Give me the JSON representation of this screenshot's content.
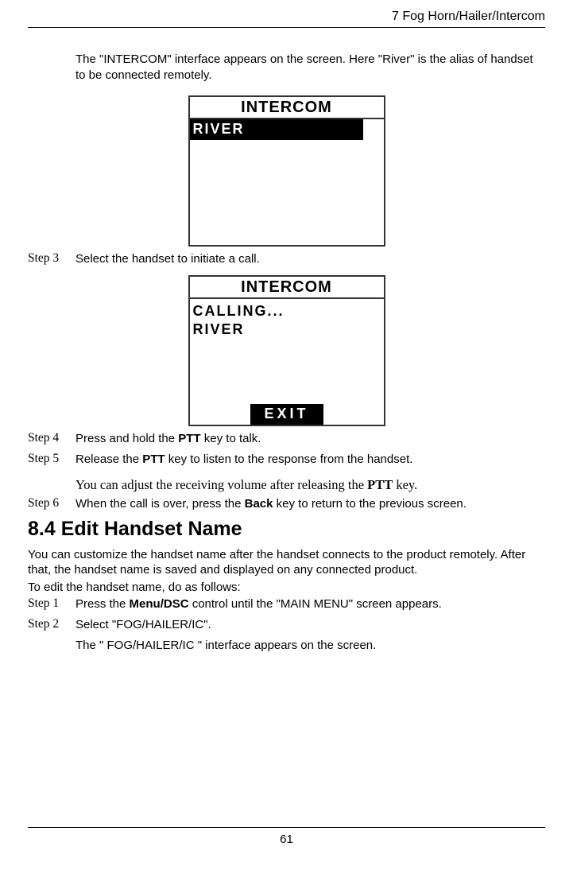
{
  "header": "7  Fog  Horn/Hailer/Intercom",
  "intro": "The \"INTERCOM\" interface appears on the screen. Here \"River\" is the alias of handset to be connected remotely.",
  "lcd1": {
    "title": "INTERCOM",
    "row1": "RIVER"
  },
  "steps": {
    "s3_label": "Step 3",
    "s3_text": "Select the handset to initiate a call.",
    "s4_label": "Step 4",
    "s4_text_a": "Press and hold the ",
    "s4_text_b": "PTT",
    "s4_text_c": " key to talk.",
    "s5_label": "Step 5",
    "s5_text_a": "Release the ",
    "s5_text_b": "PTT",
    "s5_text_c": " key to listen to the response from the handset.",
    "s6_label": "Step 6",
    "s6_text_a": "When the call is over, press the ",
    "s6_text_b": "Back",
    "s6_text_c": " key to return to the previous screen."
  },
  "lcd2": {
    "title": "INTERCOM",
    "row1": "CALLING...",
    "row2": "RIVER",
    "button": "EXIT"
  },
  "note_a": "You can adjust the receiving volume after releasing the ",
  "note_b": "PTT",
  "note_c": " key.",
  "section_heading": "8.4 Edit Handset Name",
  "para1": "You can customize the handset name after the handset connects to the product remotely. After that, the handset name is saved and displayed on any connected product.",
  "para2": "To edit the handset name, do as follows:",
  "steps2": {
    "s1_label": "Step 1",
    "s1_text_a": "Press the ",
    "s1_text_b": "Menu/DSC",
    "s1_text_c": " control until the \"MAIN MENU\" screen appears.",
    "s2_label": "Step 2",
    "s2_text": "Select \"FOG/HAILER/IC\".",
    "s2_sub": "The \" FOG/HAILER/IC \" interface appears on the screen."
  },
  "page_number": "61"
}
